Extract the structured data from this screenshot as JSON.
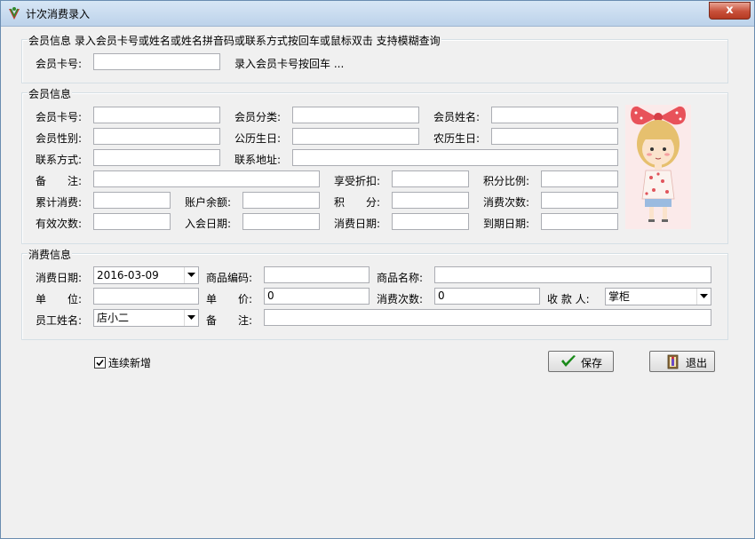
{
  "window": {
    "title": "计次消费录入",
    "close_glyph": "x"
  },
  "search": {
    "legend": "会员信息 录入会员卡号或姓名或姓名拼音码或联系方式按回车或鼠标双击 支持模糊查询",
    "card_label": "会员卡号:",
    "card_value": "",
    "hint": "录入会员卡号按回车 ..."
  },
  "member": {
    "legend": "会员信息",
    "card_no_label": "会员卡号:",
    "category_label": "会员分类:",
    "name_label": "会员姓名:",
    "gender_label": "会员性别:",
    "birthday_label": "公历生日:",
    "lunar_birthday_label": "农历生日:",
    "contact_label": "联系方式:",
    "address_label": "联系地址:",
    "remark_label": "备　　注:",
    "discount_label": "享受折扣:",
    "points_ratio_label": "积分比例:",
    "total_spend_label": "累计消费:",
    "balance_label": "账户余额:",
    "points_label": "积　　分:",
    "spend_count_label": "消费次数:",
    "valid_count_label": "有效次数:",
    "join_date_label": "入会日期:",
    "last_spend_date_label": "消费日期:",
    "expire_date_label": "到期日期:",
    "photo_icon": "member-avatar-cartoon-girl"
  },
  "consume": {
    "legend": "消费信息",
    "date_label": "消费日期:",
    "date_value": "2016-03-09",
    "goods_code_label": "商品编码:",
    "goods_code_value": "",
    "goods_name_label": "商品名称:",
    "goods_name_value": "",
    "unit_label": "单　　位:",
    "unit_value": "",
    "price_label": "单　　价:",
    "price_value": "0",
    "count_label": "消费次数:",
    "count_value": "0",
    "cashier_label": "收 款 人:",
    "cashier_value": "掌柜",
    "staff_label": "员工姓名:",
    "staff_value": "店小二",
    "remark_label": "备　　注:",
    "remark_value": ""
  },
  "footer": {
    "continue_label": "连续新增",
    "continue_checked": true,
    "save_label": "保存",
    "exit_label": "退出"
  },
  "colors": {
    "accent_check": "#1a8a1a",
    "close_red": "#c8503a"
  }
}
